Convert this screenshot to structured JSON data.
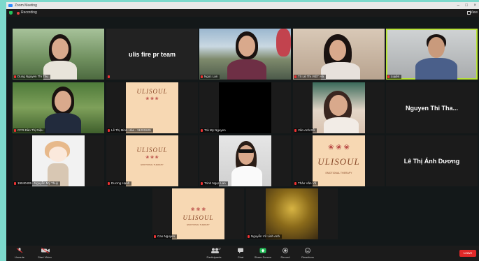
{
  "window": {
    "title": "Zoom Meeting",
    "minimize": "–",
    "maximize": "□",
    "close": "×"
  },
  "infobar": {
    "recording_label": "Recording",
    "view_label": "View"
  },
  "participants": {
    "row1": [
      {
        "label": "Dung Nguyen Thi Thu"
      },
      {
        "display_name": "ulis fire pr team"
      },
      {
        "label": "Ngoc Lan"
      },
      {
        "label": "Tô Lệ Thi VIỆT Hà"
      },
      {
        "label": "Luyện"
      }
    ],
    "row2": [
      {
        "label": "CFR Đào Thị Diệu"
      },
      {
        "label": "Lê Thị Minh Hòa - 11201529"
      },
      {
        "label": "Trà My Nguyen"
      },
      {
        "label": "Vân Anh Đỗ"
      },
      {
        "display_name": "Nguyen Thi Tha..."
      }
    ],
    "row3": [
      {
        "label": "19040405 - Nguyễn Mỹ Thuỳ"
      },
      {
        "label": "Dương Hạnh"
      },
      {
        "label": "Trinh Ngọc Lan"
      },
      {
        "label": "Thảo Vân Vũ"
      },
      {
        "display_name": "Lê Thị Ánh Dương"
      }
    ],
    "row4": [
      {
        "label": "Cao Nguyen"
      },
      {
        "label": "Nguyễn Vũ Linh Anh"
      }
    ]
  },
  "brand": {
    "name": "ULISOUL",
    "flowers": "❀ ❀ ❀",
    "tagline": "EMOTIONAL THERAPY"
  },
  "toolbar": {
    "unmute": "Unmute",
    "start_video": "Start Video",
    "participants": "Participants",
    "participants_count": "37",
    "chat": "Chat",
    "share_screen": "Share Screen",
    "record": "Record",
    "reactions": "Reactions",
    "leave": "Leave"
  },
  "colors": {
    "accent_teal": "#7dd9cc",
    "active_speaker": "#b8e23a",
    "share_green": "#23c25a",
    "leave_red": "#e02828",
    "brand_bg": "#f7d8b3"
  }
}
